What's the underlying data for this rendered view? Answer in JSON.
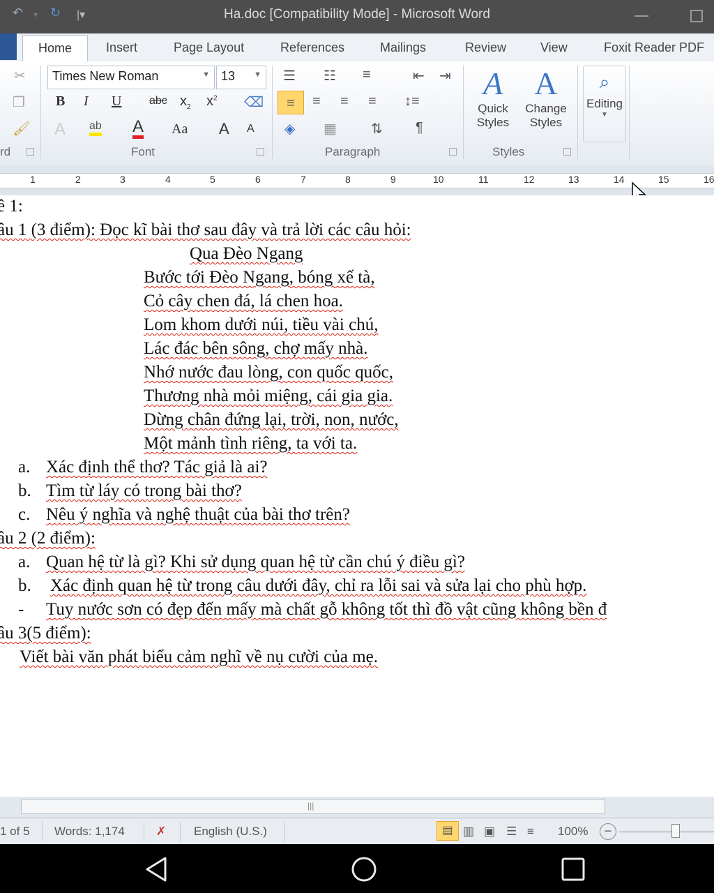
{
  "window": {
    "title": "Ha.doc [Compatibility Mode] - Microsoft Word"
  },
  "tabs": [
    "Home",
    "Insert",
    "Page Layout",
    "References",
    "Mailings",
    "Review",
    "View",
    "Foxit Reader PDF"
  ],
  "ribbon": {
    "font_name": "Times New Roman",
    "font_size": "13",
    "clipboard_label": "rd",
    "font_label": "Font",
    "paragraph_label": "Paragraph",
    "styles_label": "Styles",
    "quick_styles": [
      "Quick",
      "Styles"
    ],
    "change_styles": [
      "Change",
      "Styles"
    ],
    "editing_label": "Editing"
  },
  "ruler_numbers": [
    "1",
    "2",
    "3",
    "4",
    "5",
    "6",
    "7",
    "8",
    "9",
    "10",
    "11",
    "12",
    "13",
    "14",
    "15",
    "16"
  ],
  "document": {
    "heading": "ề 1:",
    "q1_title": "âu 1 (3 điểm): Đọc kĩ bài thơ sau đây và trả lời các câu hỏi:",
    "poem_title": "Qua Đèo Ngang",
    "poem_lines": [
      "Bước tới Đèo Ngang, bóng xế tà,",
      "Cỏ cây chen đá, lá chen hoa.",
      "Lom khom dưới núi, tiều vài chú,",
      "Lác đác bên sông, chợ mấy nhà.",
      "Nhớ nước đau lòng, con quốc quốc,",
      "Thương nhà mỏi miệng, cái gia gia.",
      "Dừng chân đứng lại, trời, non, nước,",
      "Một mảnh tình riêng, ta với ta."
    ],
    "q1_items": [
      {
        "marker": "a.",
        "text": "Xác định thể thơ? Tác giả là ai?"
      },
      {
        "marker": "b.",
        "text": "Tìm từ láy có trong bài thơ?"
      },
      {
        "marker": "c.",
        "text": "Nêu ý nghĩa và nghệ thuật của bài thơ trên?"
      }
    ],
    "q2_title": "âu 2 (2 điểm):",
    "q2_items": [
      {
        "marker": "a.",
        "text": "Quan hệ từ là gì? Khi sử dụng quan hệ từ cần chú ý điều gì?"
      },
      {
        "marker": "b.",
        "text": "Xác định quan hệ từ trong câu dưới đây, chỉ ra lỗi sai và sửa lại cho phù hợp."
      },
      {
        "marker": "-",
        "text": "Tuy nước sơn có đẹp đến mấy mà chất gỗ không tốt thì đồ vật cũng không bền đ"
      }
    ],
    "q3_title": "âu 3(5 điểm):",
    "q3_text": "Viết bài văn phát biểu cảm nghĩ về nụ cười của mẹ."
  },
  "status": {
    "page": "1 of 5",
    "words": "Words: 1,174",
    "language": "English (U.S.)",
    "zoom": "100%"
  },
  "icons": [
    "undo-icon",
    "redo-icon",
    "cut-icon",
    "copy-icon",
    "format-painter-icon",
    "bullets-icon",
    "numbering-icon",
    "find-icon",
    "mouse-cursor-icon",
    "back-nav-icon",
    "home-nav-icon",
    "recents-nav-icon"
  ],
  "colors": {
    "title_bar": "#4d4d4d",
    "accent": "#2b5797",
    "spell_error": "#d21111"
  }
}
